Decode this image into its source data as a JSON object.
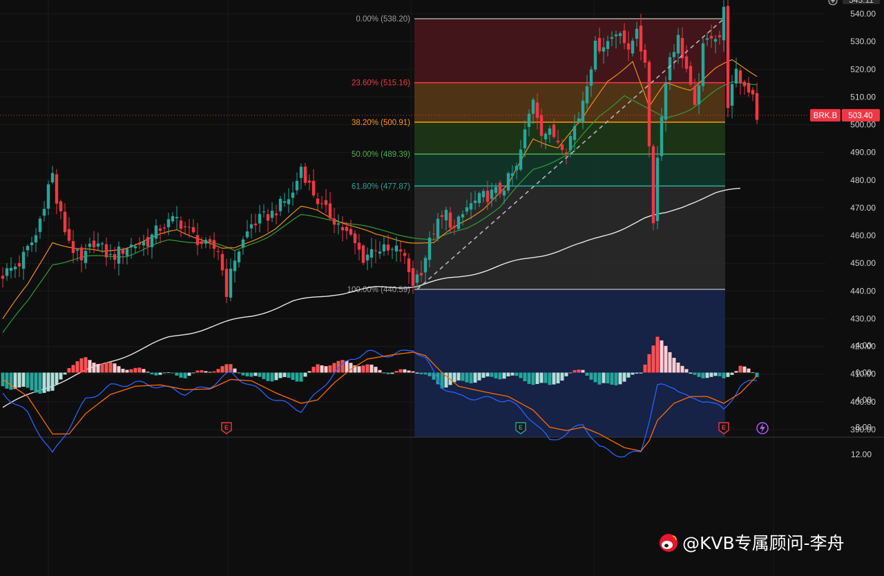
{
  "chart_data": {
    "type": "candlestick",
    "symbol": "BRK.B",
    "last_price": "503.40",
    "top_price_label": "543.11",
    "y_ticks": [
      540,
      530,
      520,
      510,
      500,
      490,
      480,
      470,
      460,
      450,
      440,
      430,
      420,
      410,
      400,
      390
    ],
    "ylim": [
      388,
      541.5
    ],
    "n_bars": 181,
    "fib_levels": [
      {
        "label": "0.00% (538.20)",
        "price": 538.2,
        "color": "#9e9e9e"
      },
      {
        "label": "23.60% (515.16)",
        "price": 515.16,
        "color": "#f23645"
      },
      {
        "label": "38.20% (500.91)",
        "price": 500.91,
        "color": "#ff9800"
      },
      {
        "label": "50.00% (489.39)",
        "price": 489.39,
        "color": "#4caf50"
      },
      {
        "label": "61.80% (477.87)",
        "price": 477.87,
        "color": "#26a69a"
      },
      {
        "label": "100.00% (440.59)",
        "price": 440.59,
        "color": "#9e9e9e"
      }
    ],
    "fib_zone_colors": [
      "#4a161b",
      "#5a3a16",
      "#1f3a18",
      "#123a2c",
      "#2c2c2c",
      "#17254d"
    ],
    "fib_start_index": 100,
    "fib_end_index": 174,
    "earnings_markers": [
      {
        "index": 54,
        "label": "E",
        "color": "#f23645"
      },
      {
        "index": 125,
        "label": "E",
        "color": "#26a69a"
      },
      {
        "index": 174,
        "label": "E",
        "color": "#f23645"
      }
    ],
    "extra_marker": {
      "index": 184,
      "icon": "lightning-icon",
      "color": "#b05cff"
    },
    "price_anchors": [
      [
        0,
        446
      ],
      [
        4,
        450
      ],
      [
        8,
        460
      ],
      [
        11,
        478
      ],
      [
        12,
        482
      ],
      [
        13,
        472
      ],
      [
        15,
        462
      ],
      [
        17,
        455
      ],
      [
        19,
        450
      ],
      [
        22,
        458
      ],
      [
        26,
        452
      ],
      [
        30,
        456
      ],
      [
        35,
        458
      ],
      [
        38,
        463
      ],
      [
        42,
        466
      ],
      [
        46,
        460
      ],
      [
        49,
        456
      ],
      [
        52,
        455
      ],
      [
        54,
        440
      ],
      [
        56,
        452
      ],
      [
        60,
        464
      ],
      [
        65,
        468
      ],
      [
        70,
        475
      ],
      [
        72,
        485
      ],
      [
        74,
        478
      ],
      [
        77,
        470
      ],
      [
        80,
        466
      ],
      [
        84,
        459
      ],
      [
        87,
        452
      ],
      [
        90,
        456
      ],
      [
        93,
        454
      ],
      [
        96,
        455
      ],
      [
        99,
        443
      ],
      [
        101,
        448
      ],
      [
        104,
        462
      ],
      [
        107,
        468
      ],
      [
        109,
        462
      ],
      [
        112,
        470
      ],
      [
        116,
        474
      ],
      [
        120,
        476
      ],
      [
        124,
        484
      ],
      [
        128,
        510
      ],
      [
        130,
        498
      ],
      [
        133,
        496
      ],
      [
        136,
        492
      ],
      [
        139,
        503
      ],
      [
        141,
        516
      ],
      [
        143,
        528
      ],
      [
        146,
        530
      ],
      [
        149,
        535
      ],
      [
        151,
        525
      ],
      [
        153,
        536
      ],
      [
        155,
        520
      ],
      [
        157,
        466
      ],
      [
        158,
        488
      ],
      [
        159,
        505
      ],
      [
        161,
        525
      ],
      [
        163,
        531
      ],
      [
        165,
        520
      ],
      [
        167,
        505
      ],
      [
        169,
        527
      ],
      [
        171,
        533
      ],
      [
        173,
        532
      ],
      [
        174,
        541
      ],
      [
        175,
        508
      ],
      [
        177,
        518
      ],
      [
        179,
        514
      ],
      [
        181,
        512
      ],
      [
        182,
        503
      ]
    ],
    "ma_fast_anchors": [
      [
        0,
        430
      ],
      [
        6,
        442
      ],
      [
        12,
        458
      ],
      [
        18,
        455
      ],
      [
        24,
        454
      ],
      [
        30,
        456
      ],
      [
        36,
        459
      ],
      [
        42,
        462
      ],
      [
        48,
        459
      ],
      [
        53,
        455
      ],
      [
        56,
        455
      ],
      [
        60,
        458
      ],
      [
        66,
        463
      ],
      [
        72,
        470
      ],
      [
        76,
        469
      ],
      [
        82,
        465
      ],
      [
        90,
        460
      ],
      [
        98,
        458
      ],
      [
        104,
        457
      ],
      [
        110,
        464
      ],
      [
        116,
        470
      ],
      [
        122,
        478
      ],
      [
        128,
        495
      ],
      [
        134,
        492
      ],
      [
        140,
        502
      ],
      [
        146,
        516
      ],
      [
        152,
        523
      ],
      [
        156,
        506
      ],
      [
        160,
        515
      ],
      [
        166,
        513
      ],
      [
        172,
        520
      ],
      [
        176,
        523
      ],
      [
        182,
        518
      ]
    ],
    "ma_mid_anchors": [
      [
        0,
        425
      ],
      [
        6,
        436
      ],
      [
        12,
        450
      ],
      [
        20,
        452
      ],
      [
        30,
        453
      ],
      [
        40,
        458
      ],
      [
        50,
        458
      ],
      [
        56,
        454
      ],
      [
        64,
        460
      ],
      [
        72,
        467
      ],
      [
        80,
        466
      ],
      [
        90,
        462
      ],
      [
        98,
        460
      ],
      [
        104,
        458
      ],
      [
        112,
        463
      ],
      [
        120,
        470
      ],
      [
        128,
        484
      ],
      [
        136,
        489
      ],
      [
        144,
        503
      ],
      [
        150,
        511
      ],
      [
        156,
        505
      ],
      [
        160,
        502
      ],
      [
        166,
        506
      ],
      [
        172,
        512
      ],
      [
        176,
        515
      ],
      [
        182,
        515
      ]
    ],
    "ma_slow_anchors": [
      [
        0,
        398
      ],
      [
        10,
        405
      ],
      [
        20,
        411
      ],
      [
        30,
        417
      ],
      [
        40,
        423
      ],
      [
        50,
        427
      ],
      [
        60,
        431
      ],
      [
        70,
        436
      ],
      [
        80,
        439
      ],
      [
        90,
        441
      ],
      [
        100,
        442
      ],
      [
        110,
        445
      ],
      [
        120,
        449
      ],
      [
        130,
        453
      ],
      [
        140,
        457
      ],
      [
        150,
        463
      ],
      [
        155,
        466
      ],
      [
        160,
        468
      ],
      [
        166,
        472
      ],
      [
        172,
        475
      ],
      [
        178,
        477
      ]
    ],
    "macd": {
      "y_ticks": [
        12.0,
        8.0,
        4.0,
        0.0,
        -4.0
      ],
      "y_tick_labels": [
        "12.00",
        "8.00",
        "4.00",
        "0.00",
        "-4.00"
      ],
      "ylim": [
        -6.2,
        13.8
      ],
      "macd_anchors": [
        [
          0,
          3
        ],
        [
          6,
          6
        ],
        [
          12,
          12
        ],
        [
          16,
          8
        ],
        [
          20,
          4
        ],
        [
          26,
          2
        ],
        [
          32,
          1.5
        ],
        [
          38,
          2
        ],
        [
          44,
          3
        ],
        [
          50,
          2
        ],
        [
          55,
          0
        ],
        [
          60,
          2
        ],
        [
          66,
          4
        ],
        [
          72,
          5.5
        ],
        [
          76,
          3
        ],
        [
          80,
          0
        ],
        [
          84,
          -2
        ],
        [
          88,
          -3
        ],
        [
          94,
          -2.5
        ],
        [
          99,
          -3.5
        ],
        [
          102,
          -2
        ],
        [
          106,
          2
        ],
        [
          110,
          3.5
        ],
        [
          116,
          3.8
        ],
        [
          122,
          4
        ],
        [
          128,
          7
        ],
        [
          132,
          10
        ],
        [
          136,
          9
        ],
        [
          140,
          7.5
        ],
        [
          144,
          11
        ],
        [
          150,
          12.3
        ],
        [
          154,
          11.5
        ],
        [
          156,
          7
        ],
        [
          158,
          2
        ],
        [
          162,
          2
        ],
        [
          166,
          4
        ],
        [
          170,
          4
        ],
        [
          174,
          5.5
        ],
        [
          178,
          2
        ],
        [
          182,
          1
        ]
      ],
      "signal_anchors": [
        [
          0,
          1
        ],
        [
          6,
          3.5
        ],
        [
          12,
          9
        ],
        [
          16,
          9
        ],
        [
          20,
          6
        ],
        [
          26,
          3.2
        ],
        [
          32,
          2
        ],
        [
          38,
          1.8
        ],
        [
          44,
          2.5
        ],
        [
          50,
          2.4
        ],
        [
          55,
          1
        ],
        [
          60,
          1.2
        ],
        [
          66,
          3
        ],
        [
          72,
          4.5
        ],
        [
          76,
          4
        ],
        [
          80,
          1.5
        ],
        [
          84,
          -0.5
        ],
        [
          88,
          -2
        ],
        [
          94,
          -2.6
        ],
        [
          99,
          -3
        ],
        [
          102,
          -2.5
        ],
        [
          106,
          0
        ],
        [
          110,
          2
        ],
        [
          116,
          2.8
        ],
        [
          122,
          3.5
        ],
        [
          128,
          5.5
        ],
        [
          132,
          8
        ],
        [
          136,
          8.5
        ],
        [
          140,
          8
        ],
        [
          144,
          9
        ],
        [
          150,
          11
        ],
        [
          154,
          11.5
        ],
        [
          156,
          10
        ],
        [
          158,
          7
        ],
        [
          162,
          4.5
        ],
        [
          166,
          3.5
        ],
        [
          170,
          3.5
        ],
        [
          174,
          4.5
        ],
        [
          178,
          3
        ],
        [
          182,
          0.5
        ]
      ]
    }
  },
  "watermark": {
    "text": "@KVB专属顾问-李舟",
    "icon": "weibo-icon"
  }
}
